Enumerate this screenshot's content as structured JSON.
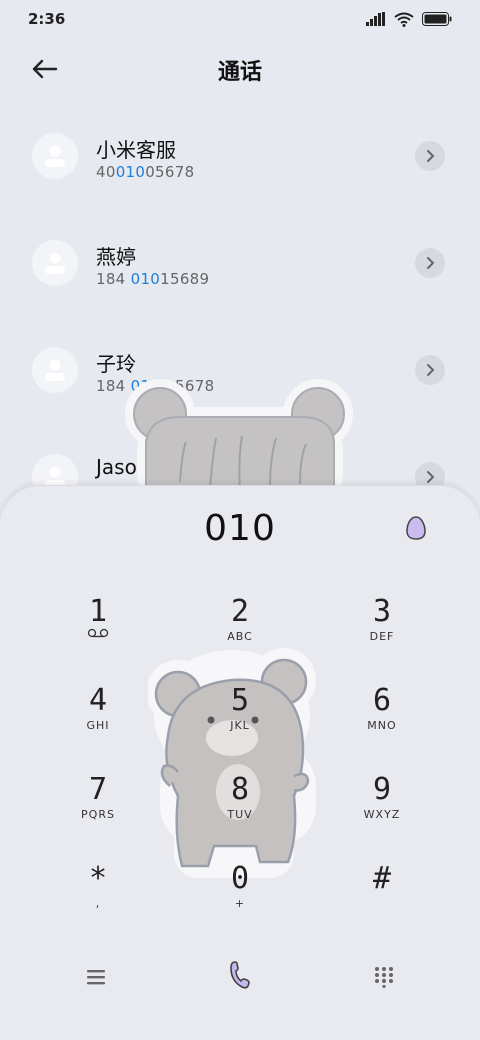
{
  "status": {
    "time": "2:36"
  },
  "header": {
    "title": "通话"
  },
  "contacts": [
    {
      "name": "小米客服",
      "number_pre": "40",
      "number_hl": "010",
      "number_post": "05678"
    },
    {
      "name": "燕婷",
      "number_pre": "184 ",
      "number_hl": "010",
      "number_post": "15689"
    },
    {
      "name": "子玲",
      "number_pre": "184 ",
      "number_hl": "0101",
      "number_post": " 5678"
    },
    {
      "name": "Jason",
      "number_pre": "",
      "number_hl": "",
      "number_post": ""
    }
  ],
  "dialer": {
    "input": "010",
    "keys": [
      {
        "digit": "1",
        "letters": "voicemail"
      },
      {
        "digit": "2",
        "letters": "ABC"
      },
      {
        "digit": "3",
        "letters": "DEF"
      },
      {
        "digit": "4",
        "letters": "GHI"
      },
      {
        "digit": "5",
        "letters": "JKL"
      },
      {
        "digit": "6",
        "letters": "MNO"
      },
      {
        "digit": "7",
        "letters": "PQRS"
      },
      {
        "digit": "8",
        "letters": "TUV"
      },
      {
        "digit": "9",
        "letters": "WXYZ"
      },
      {
        "digit": "*",
        "letters": ","
      },
      {
        "digit": "0",
        "letters": "+"
      },
      {
        "digit": "#",
        "letters": ""
      }
    ]
  },
  "colors": {
    "highlight": "#1e7fd9",
    "accent": "#b9a9e3",
    "background": "#e6e9ef"
  },
  "icons": {
    "back": "back-arrow-icon",
    "chevron": "chevron-right-icon",
    "egg": "egg-icon",
    "menu": "menu-icon",
    "call": "phone-icon",
    "keypad": "keypad-icon"
  }
}
